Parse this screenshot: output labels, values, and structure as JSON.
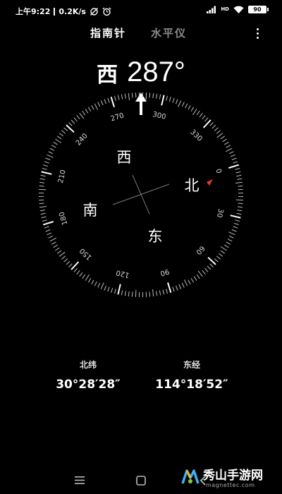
{
  "status_bar": {
    "time": "上午9:22",
    "speed": "0.2K/s",
    "battery": "90",
    "network": "HD"
  },
  "tabs": [
    {
      "label": "指南针",
      "active": true
    },
    {
      "label": "水平仪",
      "active": false
    }
  ],
  "heading": {
    "direction": "西",
    "degrees": "287°"
  },
  "compass": {
    "rotation_deg": 287,
    "cardinals": [
      "北",
      "东",
      "南",
      "西"
    ],
    "degree_labels": [
      "0",
      "30",
      "60",
      "90",
      "120",
      "150",
      "180",
      "210",
      "240",
      "270",
      "300",
      "330"
    ],
    "north_marker_color": "#e53935"
  },
  "latitude": {
    "label": "北纬",
    "value": "30°28′28″"
  },
  "longitude": {
    "label": "东经",
    "value": "114°18′52″"
  },
  "watermark": {
    "title": "秀山手游网",
    "url": "magnettec.com"
  },
  "colors": {
    "background": "#000000",
    "text": "#ffffff",
    "inactive_tab": "#8a8a8a",
    "tick": "#bdbdbd"
  }
}
